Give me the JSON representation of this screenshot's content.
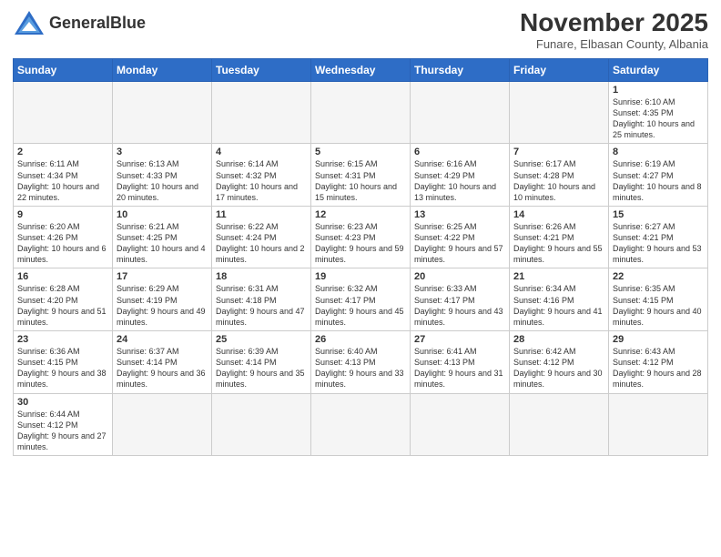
{
  "logo": {
    "text_normal": "General",
    "text_bold": "Blue"
  },
  "header": {
    "month": "November 2025",
    "location": "Funare, Elbasan County, Albania"
  },
  "weekdays": [
    "Sunday",
    "Monday",
    "Tuesday",
    "Wednesday",
    "Thursday",
    "Friday",
    "Saturday"
  ],
  "weeks": [
    [
      {
        "day": "",
        "info": ""
      },
      {
        "day": "",
        "info": ""
      },
      {
        "day": "",
        "info": ""
      },
      {
        "day": "",
        "info": ""
      },
      {
        "day": "",
        "info": ""
      },
      {
        "day": "",
        "info": ""
      },
      {
        "day": "1",
        "info": "Sunrise: 6:10 AM\nSunset: 4:35 PM\nDaylight: 10 hours and 25 minutes."
      }
    ],
    [
      {
        "day": "2",
        "info": "Sunrise: 6:11 AM\nSunset: 4:34 PM\nDaylight: 10 hours and 22 minutes."
      },
      {
        "day": "3",
        "info": "Sunrise: 6:13 AM\nSunset: 4:33 PM\nDaylight: 10 hours and 20 minutes."
      },
      {
        "day": "4",
        "info": "Sunrise: 6:14 AM\nSunset: 4:32 PM\nDaylight: 10 hours and 17 minutes."
      },
      {
        "day": "5",
        "info": "Sunrise: 6:15 AM\nSunset: 4:31 PM\nDaylight: 10 hours and 15 minutes."
      },
      {
        "day": "6",
        "info": "Sunrise: 6:16 AM\nSunset: 4:29 PM\nDaylight: 10 hours and 13 minutes."
      },
      {
        "day": "7",
        "info": "Sunrise: 6:17 AM\nSunset: 4:28 PM\nDaylight: 10 hours and 10 minutes."
      },
      {
        "day": "8",
        "info": "Sunrise: 6:19 AM\nSunset: 4:27 PM\nDaylight: 10 hours and 8 minutes."
      }
    ],
    [
      {
        "day": "9",
        "info": "Sunrise: 6:20 AM\nSunset: 4:26 PM\nDaylight: 10 hours and 6 minutes."
      },
      {
        "day": "10",
        "info": "Sunrise: 6:21 AM\nSunset: 4:25 PM\nDaylight: 10 hours and 4 minutes."
      },
      {
        "day": "11",
        "info": "Sunrise: 6:22 AM\nSunset: 4:24 PM\nDaylight: 10 hours and 2 minutes."
      },
      {
        "day": "12",
        "info": "Sunrise: 6:23 AM\nSunset: 4:23 PM\nDaylight: 9 hours and 59 minutes."
      },
      {
        "day": "13",
        "info": "Sunrise: 6:25 AM\nSunset: 4:22 PM\nDaylight: 9 hours and 57 minutes."
      },
      {
        "day": "14",
        "info": "Sunrise: 6:26 AM\nSunset: 4:21 PM\nDaylight: 9 hours and 55 minutes."
      },
      {
        "day": "15",
        "info": "Sunrise: 6:27 AM\nSunset: 4:21 PM\nDaylight: 9 hours and 53 minutes."
      }
    ],
    [
      {
        "day": "16",
        "info": "Sunrise: 6:28 AM\nSunset: 4:20 PM\nDaylight: 9 hours and 51 minutes."
      },
      {
        "day": "17",
        "info": "Sunrise: 6:29 AM\nSunset: 4:19 PM\nDaylight: 9 hours and 49 minutes."
      },
      {
        "day": "18",
        "info": "Sunrise: 6:31 AM\nSunset: 4:18 PM\nDaylight: 9 hours and 47 minutes."
      },
      {
        "day": "19",
        "info": "Sunrise: 6:32 AM\nSunset: 4:17 PM\nDaylight: 9 hours and 45 minutes."
      },
      {
        "day": "20",
        "info": "Sunrise: 6:33 AM\nSunset: 4:17 PM\nDaylight: 9 hours and 43 minutes."
      },
      {
        "day": "21",
        "info": "Sunrise: 6:34 AM\nSunset: 4:16 PM\nDaylight: 9 hours and 41 minutes."
      },
      {
        "day": "22",
        "info": "Sunrise: 6:35 AM\nSunset: 4:15 PM\nDaylight: 9 hours and 40 minutes."
      }
    ],
    [
      {
        "day": "23",
        "info": "Sunrise: 6:36 AM\nSunset: 4:15 PM\nDaylight: 9 hours and 38 minutes."
      },
      {
        "day": "24",
        "info": "Sunrise: 6:37 AM\nSunset: 4:14 PM\nDaylight: 9 hours and 36 minutes."
      },
      {
        "day": "25",
        "info": "Sunrise: 6:39 AM\nSunset: 4:14 PM\nDaylight: 9 hours and 35 minutes."
      },
      {
        "day": "26",
        "info": "Sunrise: 6:40 AM\nSunset: 4:13 PM\nDaylight: 9 hours and 33 minutes."
      },
      {
        "day": "27",
        "info": "Sunrise: 6:41 AM\nSunset: 4:13 PM\nDaylight: 9 hours and 31 minutes."
      },
      {
        "day": "28",
        "info": "Sunrise: 6:42 AM\nSunset: 4:12 PM\nDaylight: 9 hours and 30 minutes."
      },
      {
        "day": "29",
        "info": "Sunrise: 6:43 AM\nSunset: 4:12 PM\nDaylight: 9 hours and 28 minutes."
      }
    ],
    [
      {
        "day": "30",
        "info": "Sunrise: 6:44 AM\nSunset: 4:12 PM\nDaylight: 9 hours and 27 minutes."
      },
      {
        "day": "",
        "info": ""
      },
      {
        "day": "",
        "info": ""
      },
      {
        "day": "",
        "info": ""
      },
      {
        "day": "",
        "info": ""
      },
      {
        "day": "",
        "info": ""
      },
      {
        "day": "",
        "info": ""
      }
    ]
  ]
}
